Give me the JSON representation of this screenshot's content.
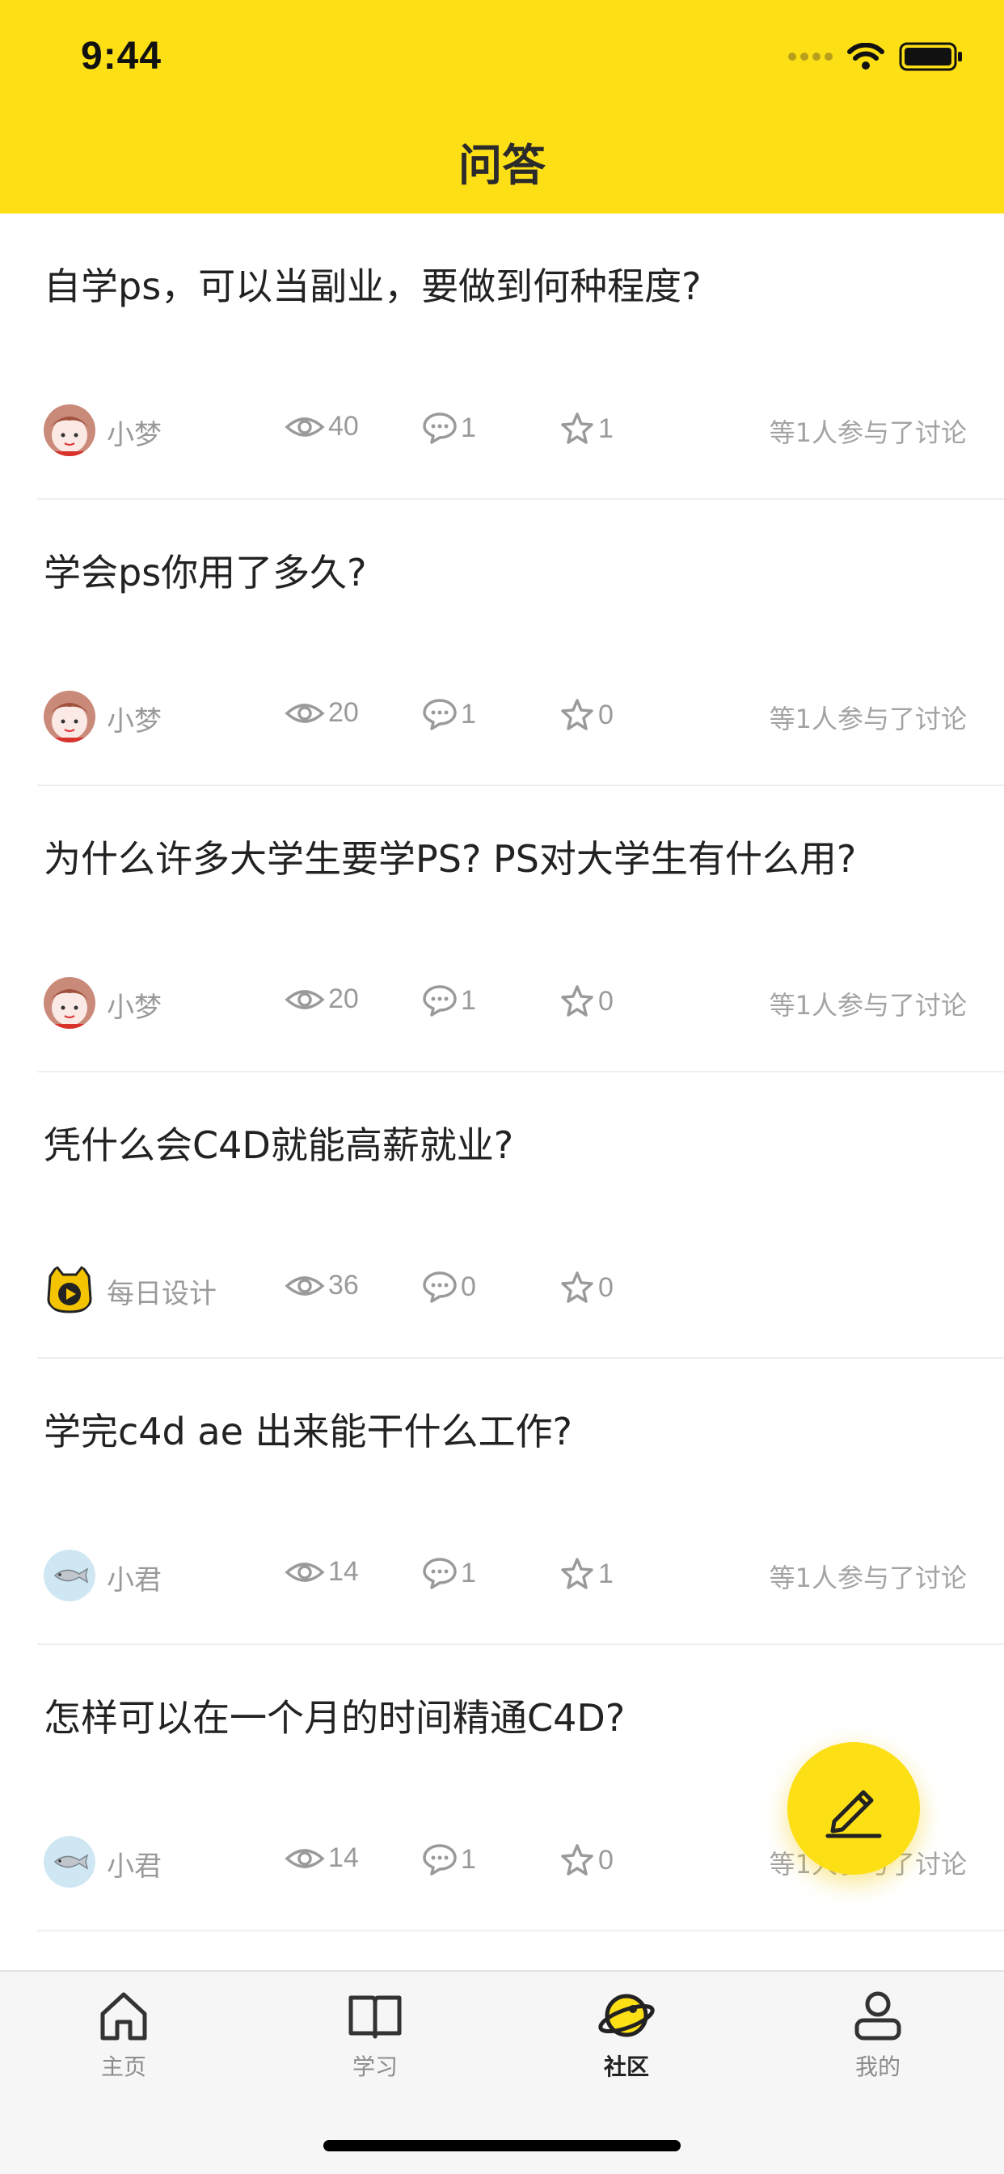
{
  "status_bar": {
    "time": "9:44"
  },
  "header": {
    "title": "问答"
  },
  "questions": [
    {
      "title": "自学ps，可以当副业，要做到何种程度?",
      "author": "小梦",
      "avatar": "girl",
      "views": "40",
      "comments": "1",
      "stars": "1",
      "participants": "等1人参与了讨论"
    },
    {
      "title": "学会ps你用了多久?",
      "author": "小梦",
      "avatar": "girl",
      "views": "20",
      "comments": "1",
      "stars": "0",
      "participants": "等1人参与了讨论"
    },
    {
      "title": "为什么许多大学生要学PS?  PS对大学生有什么用?",
      "author": "小梦",
      "avatar": "girl",
      "views": "20",
      "comments": "1",
      "stars": "0",
      "participants": "等1人参与了讨论"
    },
    {
      "title": "凭什么会C4D就能高薪就业?",
      "author": "每日设计",
      "avatar": "yellow-mascot",
      "views": "36",
      "comments": "0",
      "stars": "0",
      "participants": ""
    },
    {
      "title": "学完c4d ae 出来能干什么工作?",
      "author": "小君",
      "avatar": "fish",
      "views": "14",
      "comments": "1",
      "stars": "1",
      "participants": "等1人参与了讨论"
    },
    {
      "title": "怎样可以在一个月的时间精通C4D?",
      "author": "小君",
      "avatar": "fish",
      "views": "14",
      "comments": "1",
      "stars": "0",
      "participants": "等1人参与了讨论"
    }
  ],
  "fab": {
    "icon": "pencil-icon"
  },
  "tabbar": {
    "items": [
      {
        "label": "主页",
        "icon": "home-icon",
        "active": false
      },
      {
        "label": "学习",
        "icon": "book-icon",
        "active": false
      },
      {
        "label": "社区",
        "icon": "planet-icon",
        "active": true
      },
      {
        "label": "我的",
        "icon": "user-icon",
        "active": false
      }
    ]
  },
  "colors": {
    "accent": "#FDDF16",
    "meta_text": "#9a9a9a",
    "divider": "#eeeeee"
  }
}
